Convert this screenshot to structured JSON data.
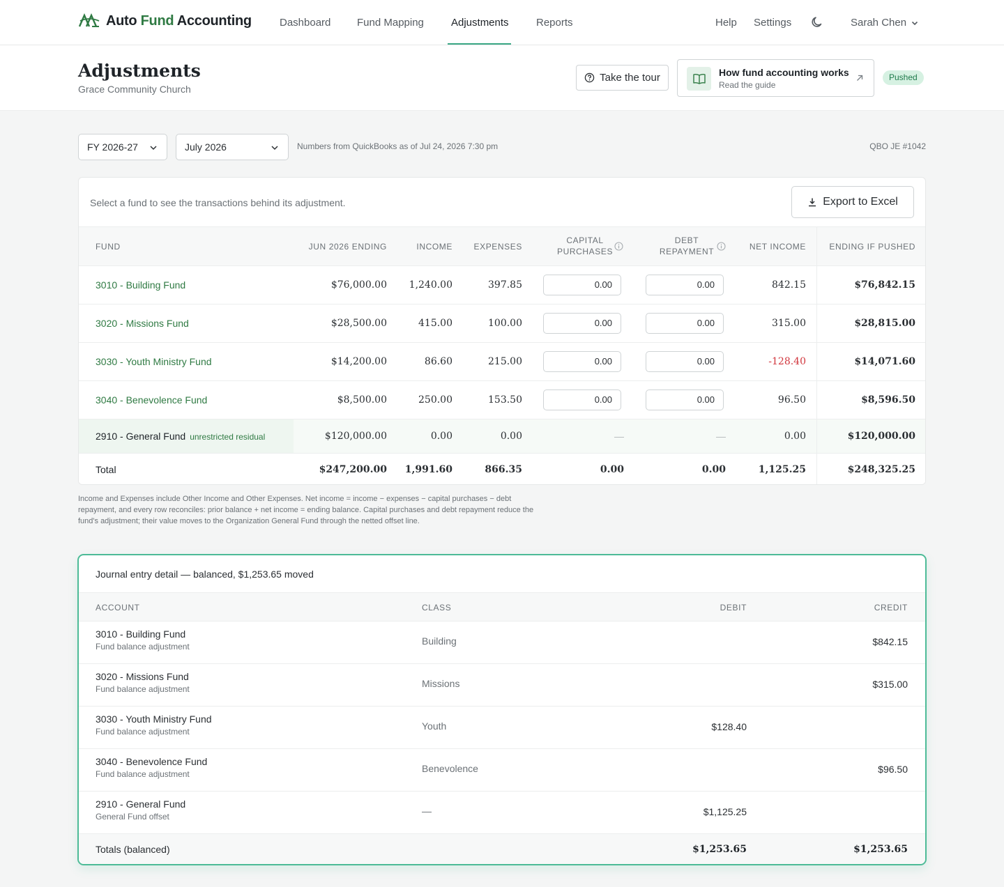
{
  "nav": {
    "brand": {
      "part1": "Auto ",
      "part2": "Fund",
      "part3": " Accounting"
    },
    "links": [
      "Dashboard",
      "Fund Mapping",
      "Adjustments",
      "Reports"
    ],
    "active": "Adjustments",
    "help": "Help",
    "settings": "Settings",
    "user": "Sarah Chen"
  },
  "header": {
    "title": "Adjustments",
    "org": "Grace Community Church",
    "tour_label": "Take the tour",
    "guide_title": "How fund accounting works",
    "guide_sub": "Read the guide",
    "status": "Pushed"
  },
  "filters": {
    "fiscal_year": "FY 2026-27",
    "month": "July 2026",
    "as_of": "Numbers from QuickBooks as of Jul 24, 2026 7:30 pm",
    "je_number": "QBO JE #1042"
  },
  "funds_table": {
    "hint": "Select a fund to see the transactions behind its adjustment.",
    "export_label": "Export to Excel",
    "headers": {
      "fund": "FUND",
      "prior": "JUN 2026 ENDING",
      "income": "INCOME",
      "expenses": "EXPENSES",
      "capital_1": "CAPITAL",
      "capital_2": "PURCHASES",
      "debt_1": "DEBT",
      "debt_2": "REPAYMENT",
      "net": "NET INCOME",
      "ending": "ENDING IF PUSHED"
    },
    "rows": [
      {
        "fund": "3010 - Building Fund",
        "prior": "$76,000.00",
        "income": "1,240.00",
        "expenses": "397.85",
        "capital": "0.00",
        "debt": "0.00",
        "net": "842.15",
        "ending": "$76,842.15"
      },
      {
        "fund": "3020 - Missions Fund",
        "prior": "$28,500.00",
        "income": "415.00",
        "expenses": "100.00",
        "capital": "0.00",
        "debt": "0.00",
        "net": "315.00",
        "ending": "$28,815.00"
      },
      {
        "fund": "3030 - Youth Ministry Fund",
        "prior": "$14,200.00",
        "income": "86.60",
        "expenses": "215.00",
        "capital": "0.00",
        "debt": "0.00",
        "net": "-128.40",
        "ending": "$14,071.60"
      },
      {
        "fund": "3040 - Benevolence Fund",
        "prior": "$8,500.00",
        "income": "250.00",
        "expenses": "153.50",
        "capital": "0.00",
        "debt": "0.00",
        "net": "96.50",
        "ending": "$8,596.50"
      }
    ],
    "general": {
      "fund": "2910 - General Fund",
      "tag": "unrestricted residual",
      "prior": "$120,000.00",
      "income": "0.00",
      "expenses": "0.00",
      "capital": "—",
      "debt": "—",
      "net": "0.00",
      "ending": "$120,000.00"
    },
    "total": {
      "label": "Total",
      "prior": "$247,200.00",
      "income": "1,991.60",
      "expenses": "866.35",
      "capital": "0.00",
      "debt": "0.00",
      "net": "1,125.25",
      "ending": "$248,325.25"
    }
  },
  "footnote": "Income and Expenses include Other Income and Other Expenses. Net income = income − expenses − capital purchases − debt repayment, and every row reconciles: prior balance + net income = ending balance. Capital purchases and debt repayment reduce the fund's adjustment; their value moves to the Organization General Fund through the netted offset line.",
  "journal": {
    "title": "Journal entry detail — balanced, $1,253.65 moved",
    "headers": {
      "account": "ACCOUNT",
      "class": "CLASS",
      "debit": "DEBIT",
      "credit": "CREDIT"
    },
    "rows": [
      {
        "account": "3010 - Building Fund",
        "memo": "Fund balance adjustment",
        "class": "Building",
        "debit": "",
        "credit": "$842.15"
      },
      {
        "account": "3020 - Missions Fund",
        "memo": "Fund balance adjustment",
        "class": "Missions",
        "debit": "",
        "credit": "$315.00"
      },
      {
        "account": "3030 - Youth Ministry Fund",
        "memo": "Fund balance adjustment",
        "class": "Youth",
        "debit": "$128.40",
        "credit": ""
      },
      {
        "account": "3040 - Benevolence Fund",
        "memo": "Fund balance adjustment",
        "class": "Benevolence",
        "debit": "",
        "credit": "$96.50"
      },
      {
        "account": "2910 - General Fund",
        "memo": "General Fund offset",
        "class": "—",
        "debit": "$1,125.25",
        "credit": ""
      }
    ],
    "totals": {
      "label": "Totals (balanced)",
      "debit": "$1,253.65",
      "credit": "$1,253.65"
    }
  },
  "colors": {
    "accent": "#2f7a43",
    "teal": "#4dbb97",
    "negative": "#d1363d",
    "badge_bg": "#d6f1e2"
  }
}
